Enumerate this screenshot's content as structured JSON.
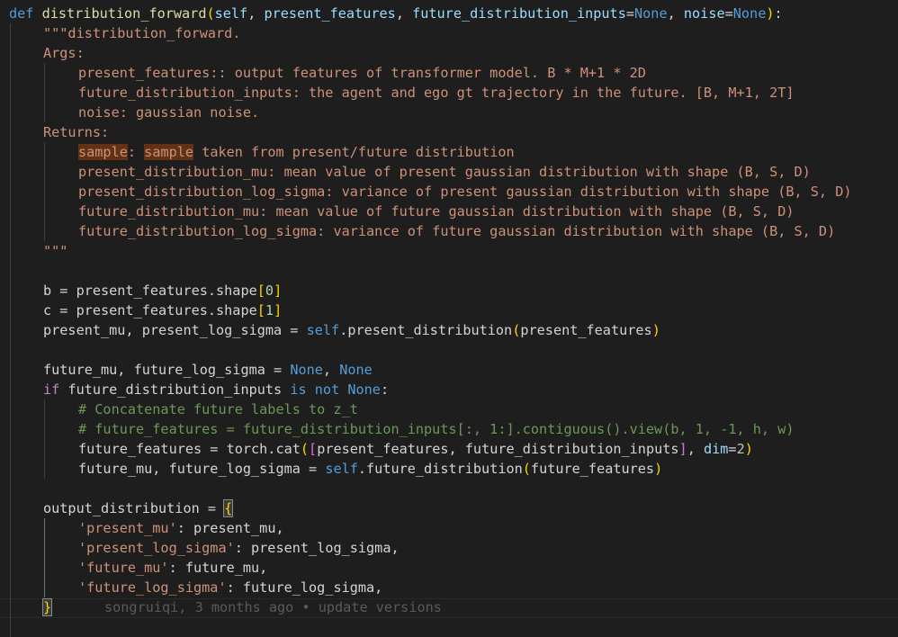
{
  "code": {
    "l1": {
      "def": "def",
      "name": "distribution_forward",
      "open": "(",
      "self": "self",
      "c1": ", ",
      "p1": "present_features",
      "c2": ", ",
      "p2": "future_distribution_inputs",
      "eq1": "=",
      "none1": "None",
      "c3": ", ",
      "p3": "noise",
      "eq2": "=",
      "none2": "None",
      "close": ")",
      "colon": ":"
    },
    "doc1": "\"\"\"distribution_forward.",
    "doc2": "Args:",
    "doc3": "present_features:: output features of transformer model. B * M+1 * 2D",
    "doc4": "future_distribution_inputs: the agent and ego gt trajectory in the future. [B, M+1, 2T]",
    "doc5": "noise: gaussian noise.",
    "doc6": "Returns:",
    "doc7": {
      "w1": "sample",
      "colon": ": ",
      "w2": "sample",
      "rest": " taken from present/future distribution"
    },
    "doc8": "present_distribution_mu: mean value of present gaussian distribution with shape (B, S, D)",
    "doc9": "present_distribution_log_sigma: variance of present gaussian distribution with shape (B, S, D)",
    "doc10": "future_distribution_mu: mean value of future gaussian distribution with shape (B, S, D)",
    "doc11": "future_distribution_log_sigma: variance of future gaussian distribution with shape (B, S, D)",
    "doc12": "\"\"\"",
    "b": {
      "lhs": "b = present_features.shape",
      "lb": "[",
      "idx": "0",
      "rb": "]"
    },
    "c": {
      "lhs": "c = present_features.shape",
      "lb": "[",
      "idx": "1",
      "rb": "]"
    },
    "pm": {
      "lhs": "present_mu, present_log_sigma = ",
      "self": "self",
      "call": ".present_distribution",
      "lp": "(",
      "arg": "present_features",
      "rp": ")"
    },
    "fm": {
      "lhs": "future_mu, future_log_sigma = ",
      "n1": "None",
      "sep": ", ",
      "n2": "None"
    },
    "iff": {
      "kw": "if",
      "mid": " future_distribution_inputs ",
      "is": "is",
      "sp": " ",
      "not": "not",
      "sp2": " ",
      "none": "None",
      "colon": ":"
    },
    "cmt1": "# Concatenate future labels to z_t",
    "cmt2": "# future_features = future_distribution_inputs[:, 1:].contiguous().view(b, 1, -1, h, w)",
    "ff": {
      "lhs": "future_features = torch.cat",
      "lp": "(",
      "lb": "[",
      "items": "present_features, future_distribution_inputs",
      "rb": "]",
      "sep": ", ",
      "kw": "dim",
      "eq": "=",
      "val": "2",
      "rp": ")"
    },
    "fm2": {
      "lhs": "future_mu, future_log_sigma = ",
      "self": "self",
      "call": ".future_distribution",
      "lp": "(",
      "arg": "future_features",
      "rp": ")"
    },
    "od": {
      "lhs": "output_distribution = ",
      "brace": "{"
    },
    "k1": {
      "key": "'present_mu'",
      "val": ": present_mu,"
    },
    "k2": {
      "key": "'present_log_sigma'",
      "val": ": present_log_sigma,"
    },
    "k3": {
      "key": "'future_mu'",
      "val": ": future_mu,"
    },
    "k4": {
      "key": "'future_log_sigma'",
      "val": ": future_log_sigma,"
    },
    "close_brace": "}",
    "blame": "songruiqi, 3 months ago • update versions"
  },
  "colors": {
    "background": "#1e1e1e",
    "keyword": "#569cd6",
    "control": "#c586c0",
    "function": "#dcdcaa",
    "string": "#ce9178",
    "comment": "#6a9955",
    "number": "#b5cea8",
    "variable": "#9cdcfe"
  }
}
